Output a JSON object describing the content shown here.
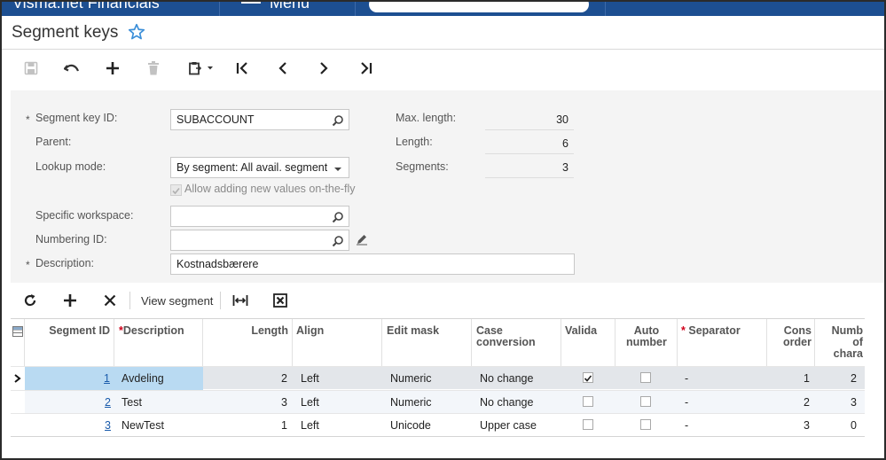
{
  "app": {
    "name": "Visma.net Financials",
    "menu_label": "Menu"
  },
  "page": {
    "title": "Segment keys"
  },
  "form": {
    "segment_key_id": {
      "label": "Segment key ID:",
      "value": "SUBACCOUNT",
      "required": "*"
    },
    "parent": {
      "label": "Parent:"
    },
    "lookup_mode": {
      "label": "Lookup mode:",
      "value": "By segment: All avail. segment values"
    },
    "allow_new_values": {
      "label": "Allow adding new values on-the-fly",
      "checked": true
    },
    "specific_workspace": {
      "label": "Specific workspace:",
      "value": ""
    },
    "numbering_id": {
      "label": "Numbering ID:",
      "value": ""
    },
    "description": {
      "label": "Description:",
      "value": "Kostnadsbærere",
      "required": "*"
    },
    "max_length": {
      "label": "Max. length:",
      "value": "30"
    },
    "length": {
      "label": "Length:",
      "value": "6"
    },
    "segments": {
      "label": "Segments:",
      "value": "3"
    }
  },
  "grid_toolbar": {
    "view_segment_label": "View segment"
  },
  "grid": {
    "columns": [
      {
        "label": "Segment ID",
        "required": false
      },
      {
        "label": "Description",
        "required": true
      },
      {
        "label": "Length",
        "required": false
      },
      {
        "label": "Align",
        "required": false
      },
      {
        "label": "Edit mask",
        "required": false
      },
      {
        "label": "Case\nconversion",
        "required": false
      },
      {
        "label": "Valida",
        "required": false
      },
      {
        "label": "Auto\nnumber",
        "required": false
      },
      {
        "label": "Separator",
        "required": true
      },
      {
        "label": "Cons\norder",
        "required": false
      },
      {
        "label": "Numb\nof\nchara",
        "required": false
      }
    ],
    "rows": [
      {
        "segment_id": "1",
        "description": "Avdeling",
        "length": "2",
        "align": "Left",
        "edit_mask": "Numeric",
        "case": "No change",
        "validate": true,
        "auto_number": false,
        "separator": "-",
        "cons_order": "1",
        "num_chars": "2",
        "selected": true
      },
      {
        "segment_id": "2",
        "description": "Test",
        "length": "3",
        "align": "Left",
        "edit_mask": "Numeric",
        "case": "No change",
        "validate": false,
        "auto_number": false,
        "separator": "-",
        "cons_order": "2",
        "num_chars": "3",
        "selected": false
      },
      {
        "segment_id": "3",
        "description": "NewTest",
        "length": "1",
        "align": "Left",
        "edit_mask": "Unicode",
        "case": "Upper case",
        "validate": false,
        "auto_number": false,
        "separator": "-",
        "cons_order": "3",
        "num_chars": "0",
        "selected": false
      }
    ]
  },
  "colors": {
    "topbar": "#1d4f91",
    "selected_row": "#e3e6ea",
    "selected_cell": "#b9daf2",
    "link": "#1a5bab",
    "required_star": "#d0021b",
    "star_icon": "#3a8ed8"
  }
}
